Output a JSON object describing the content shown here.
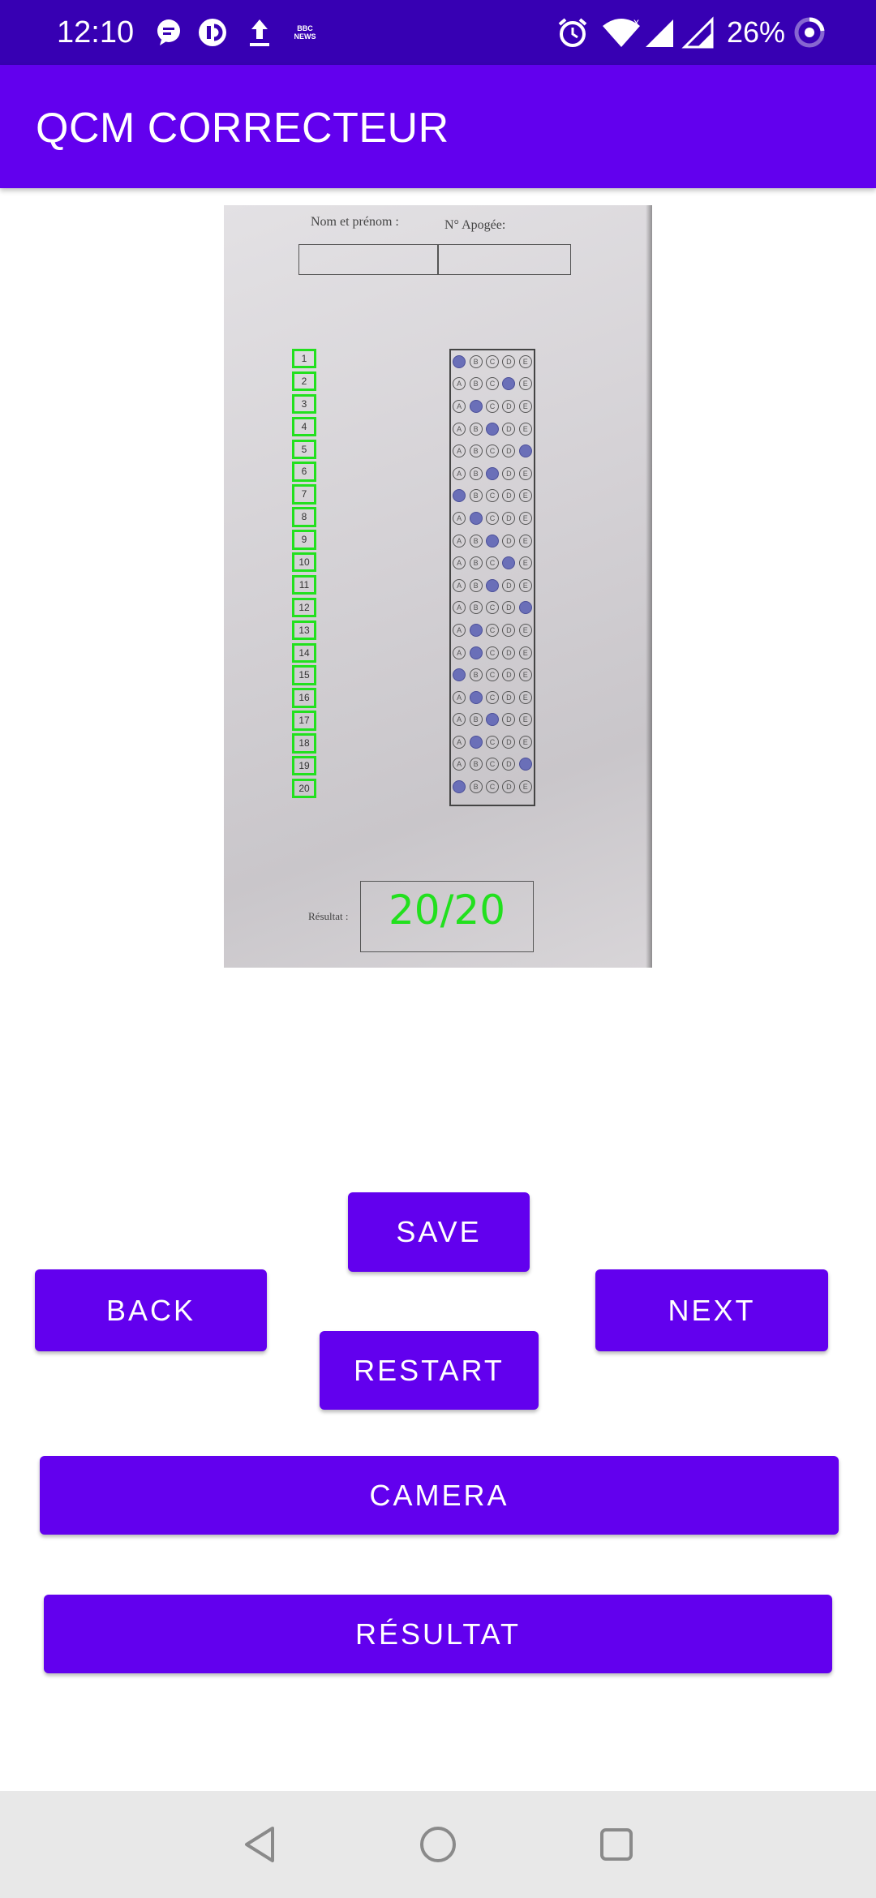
{
  "status_bar": {
    "time": "12:10",
    "battery_percent": "26%",
    "icons": [
      "message-icon",
      "pocket-casts-icon",
      "upload-icon",
      "bbc-news-icon",
      "alarm-icon",
      "wifi-icon",
      "signal-x-icon",
      "signal-icon",
      "battery-ring-icon"
    ],
    "bbc_text_top": "BBC",
    "bbc_text_bottom": "NEWS"
  },
  "app_bar": {
    "title": "QCM CORRECTEUR"
  },
  "sheet": {
    "name_label": "Nom et prénom :",
    "apogee_label": "N° Apogée:",
    "result_label": "Résultat :",
    "score": "20/20",
    "question_numbers": [
      "1",
      "2",
      "3",
      "4",
      "5",
      "6",
      "7",
      "8",
      "9",
      "10",
      "11",
      "12",
      "13",
      "14",
      "15",
      "16",
      "17",
      "18",
      "19",
      "20"
    ],
    "options": [
      "A",
      "B",
      "C",
      "D",
      "E"
    ],
    "filled_answers": [
      "A",
      "D",
      "B",
      "C",
      "E",
      "C",
      "A",
      "B",
      "C",
      "D",
      "C",
      "E",
      "B",
      "B",
      "A",
      "B",
      "C",
      "B",
      "E",
      "A"
    ],
    "highlight_color": "#22e01e"
  },
  "buttons": {
    "save": "SAVE",
    "back": "BACK",
    "next": "NEXT",
    "restart": "RESTART",
    "camera": "CAMERA",
    "resultat": "RÉSULTAT"
  },
  "colors": {
    "primary": "#6200ee",
    "primary_dark": "#3700b3",
    "nav_bar": "#e8e8e8"
  }
}
